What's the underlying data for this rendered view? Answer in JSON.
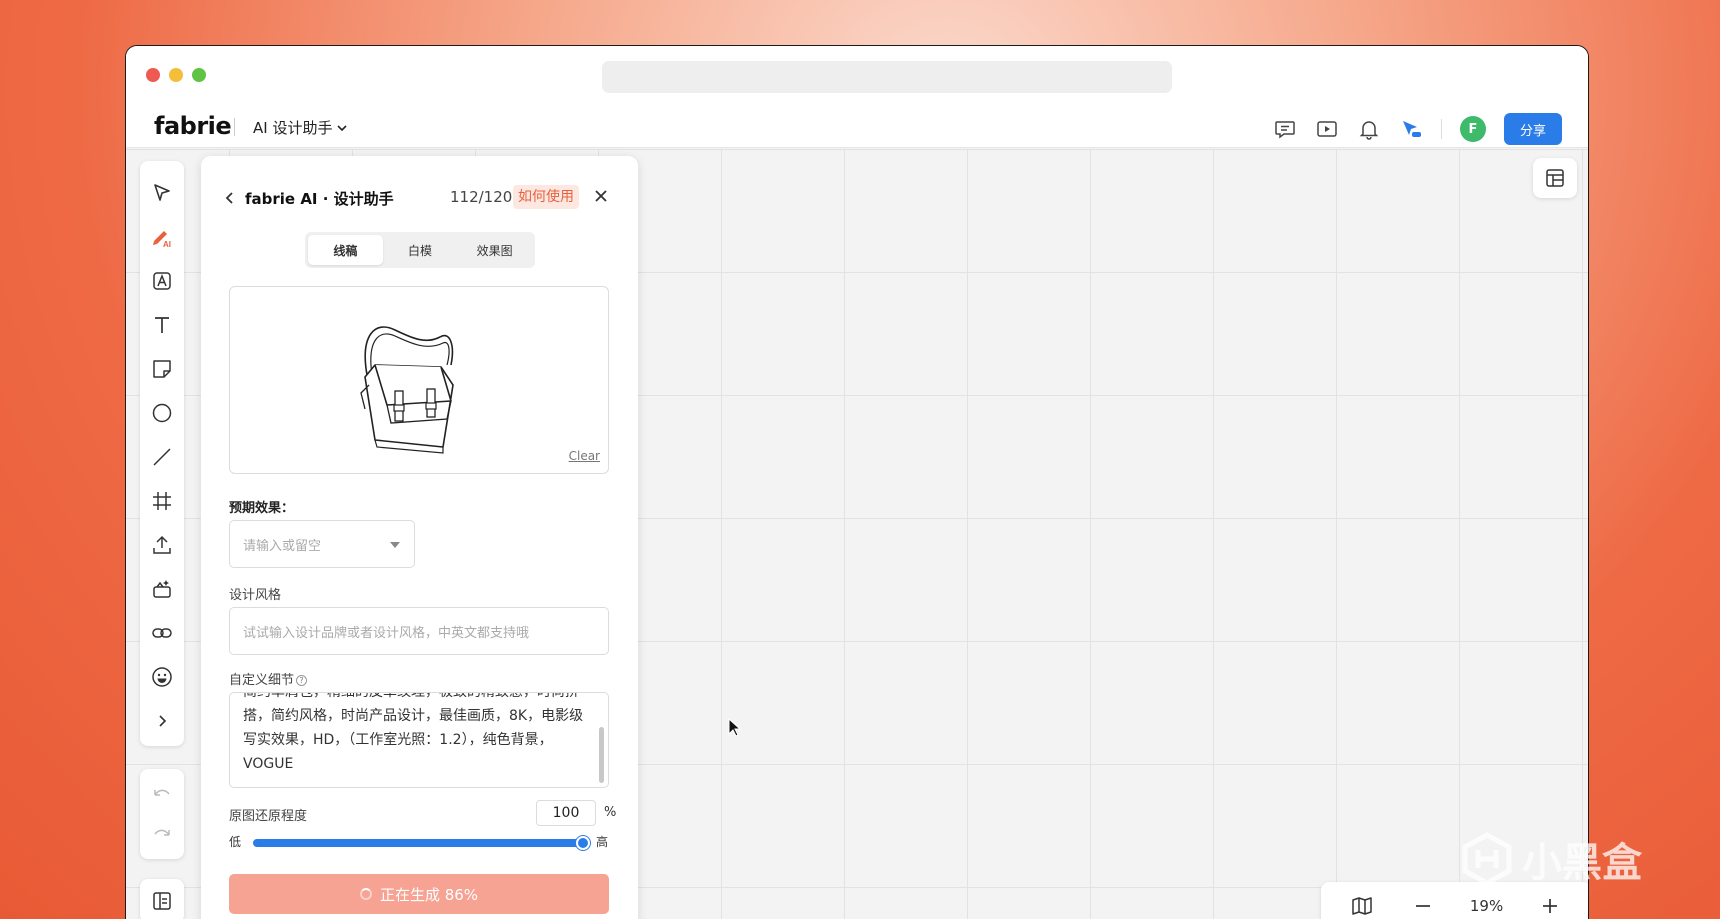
{
  "app": {
    "logo": "fabrie",
    "assistant_menu": "AI 设计助手",
    "share_label": "分享",
    "avatar_initial": "F"
  },
  "panel": {
    "title": "fabrie AI · 设计助手",
    "count": "112/120",
    "how_to_use": "如何使用",
    "tabs": [
      {
        "label": "线稿",
        "active": true
      },
      {
        "label": "白模",
        "active": false
      },
      {
        "label": "效果图",
        "active": false
      }
    ],
    "clear_label": "Clear",
    "expected_effect_label": "预期效果：",
    "expected_effect_placeholder": "请输入或留空",
    "design_style_label": "设计风格",
    "design_style_placeholder": "试试输入设计品牌或者设计风格，中英文都支持哦",
    "custom_detail_label": "自定义细节",
    "custom_detail_text": "简约单肩包，精细的皮革纹理，极致的精致感，时尚拼搭，简约风格，时尚产品设计，最佳画质，8K，电影级写实效果，HD，（工作室光照：1.2），纯色背景，VOGUE",
    "restore_label": "原图还原程度",
    "restore_value": "100",
    "restore_unit": "%",
    "slider_low": "低",
    "slider_high": "高",
    "slider_fraction": 1.0,
    "generate_label": "正在生成 86%"
  },
  "zoom": {
    "value": "19%"
  },
  "watermark": "小黑盒",
  "colors": {
    "accent_blue": "#2a7ce8",
    "accent_orange": "#e8613f",
    "avatar_green": "#3dbb6b",
    "generate_button": "#f6a393"
  }
}
